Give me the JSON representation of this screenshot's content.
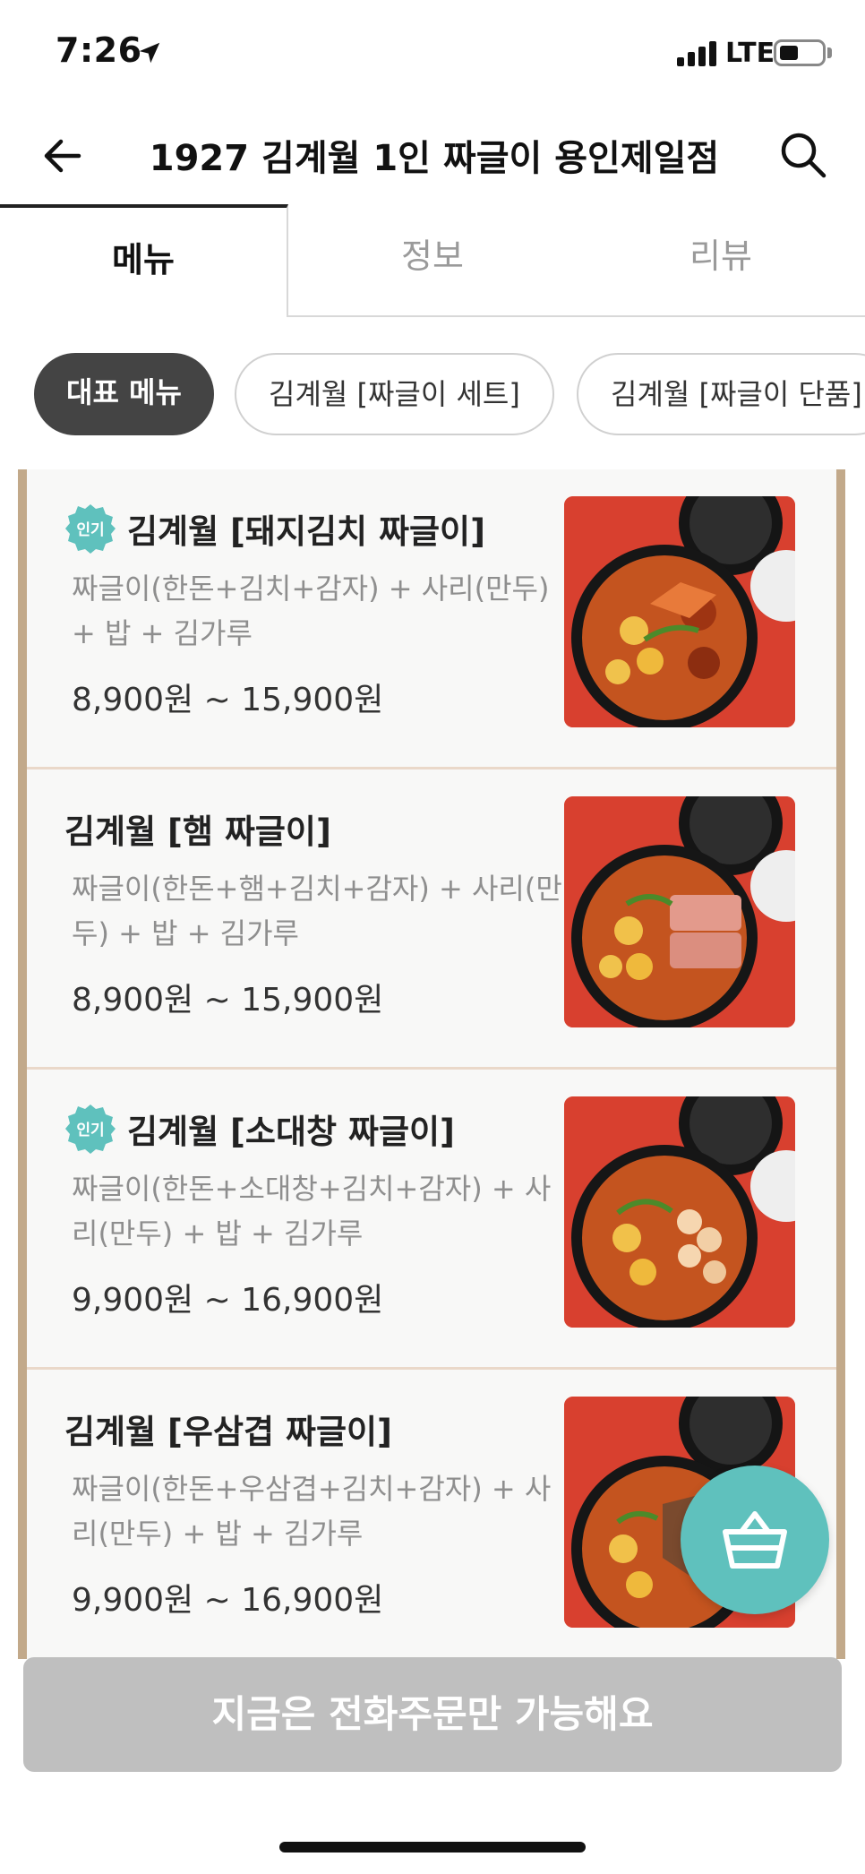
{
  "status_bar": {
    "time": "7:26",
    "network": "LTE",
    "icons": [
      "location-arrow-icon",
      "signal-icon",
      "battery-icon"
    ]
  },
  "header": {
    "title": "1927 김계월 1인 짜글이 용인제일점",
    "back_icon": "back-arrow-icon",
    "search_icon": "search-icon"
  },
  "tabs": [
    {
      "label": "메뉴",
      "active": true
    },
    {
      "label": "정보",
      "active": false
    },
    {
      "label": "리뷰",
      "active": false
    }
  ],
  "categories": [
    {
      "label": "대표 메뉴",
      "active": true
    },
    {
      "label": "김계월 [짜글이 세트]",
      "active": false
    },
    {
      "label": "김계월 [짜글이 단품]",
      "active": false
    }
  ],
  "menu_items": [
    {
      "name": "김계월 [돼지김치 짜글이]",
      "badge": "인기",
      "description": "짜글이(한돈+김치+감자) + 사리(만두) + 밥 + 김가루",
      "price": "8,900원 ~ 15,900원"
    },
    {
      "name": "김계월 [햄 짜글이]",
      "badge": "",
      "description": "짜글이(한돈+햄+김치+감자) + 사리(만두) + 밥 + 김가루",
      "price": "8,900원 ~ 15,900원"
    },
    {
      "name": "김계월 [소대창 짜글이]",
      "badge": "인기",
      "description": "짜글이(한돈+소대창+김치+감자) + 사리(만두) + 밥 + 김가루",
      "price": "9,900원 ~ 16,900원"
    },
    {
      "name": "김계월 [우삼겹 짜글이]",
      "badge": "",
      "description": "짜글이(한돈+우삼겹+김치+감자) + 사리(만두) + 밥 + 김가루",
      "price": "9,900원 ~ 16,900원"
    }
  ],
  "cart": {
    "icon": "shopping-basket-icon"
  },
  "order_bar": {
    "label": "지금은 전화주문만 가능해요"
  },
  "colors": {
    "accent_teal": "#5fc1bd",
    "active_chip": "#444444",
    "disabled_bar": "#bfbfbf",
    "frame_border": "#c2a98a",
    "thumbnail_bg": "#d8402f"
  }
}
